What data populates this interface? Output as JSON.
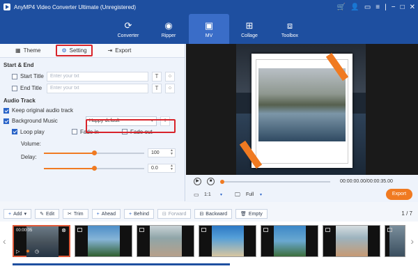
{
  "app": {
    "title": "AnyMP4 Video Converter Ultimate (Unregistered)"
  },
  "nav": [
    {
      "label": "Converter",
      "icon": "converter-icon"
    },
    {
      "label": "Ripper",
      "icon": "ripper-icon"
    },
    {
      "label": "MV",
      "icon": "mv-icon",
      "active": true
    },
    {
      "label": "Collage",
      "icon": "collage-icon"
    },
    {
      "label": "Toolbox",
      "icon": "toolbox-icon"
    }
  ],
  "tabs": {
    "theme": "Theme",
    "setting": "Setting",
    "export": "Export"
  },
  "start_end": {
    "heading": "Start & End",
    "start_label": "Start Title",
    "start_placeholder": "Enter your txt",
    "end_label": "End Title",
    "end_placeholder": "Enter your txt"
  },
  "audio": {
    "heading": "Audio Track",
    "keep_label": "Keep original audio track",
    "keep_checked": true,
    "bg_label": "Background Music",
    "bg_checked": true,
    "music": "Happy-default",
    "loop_label": "Loop play",
    "loop_checked": true,
    "fadein_label": "Fade in",
    "fadeout_label": "Fade out",
    "volume_label": "Volume:",
    "volume": "100",
    "volume_level": 1.0,
    "delay_label": "Delay:",
    "delay": "0.0",
    "delay_level": 0.5
  },
  "player": {
    "time": "00:00:00.00/00:00:35.00",
    "ratio": "1:1",
    "mode": "Full",
    "export": "Export"
  },
  "toolbar": {
    "add": "Add",
    "edit": "Edit",
    "trim": "Trim",
    "ahead": "Ahead",
    "behind": "Behind",
    "forward": "Forward",
    "backward": "Backward",
    "empty": "Empty"
  },
  "timeline": {
    "page": "1 / 7",
    "first_duration": "00:00:05"
  },
  "colors": {
    "brand": "#1e4fa0",
    "accent": "#f07a21",
    "highlight": "#d8232a"
  }
}
